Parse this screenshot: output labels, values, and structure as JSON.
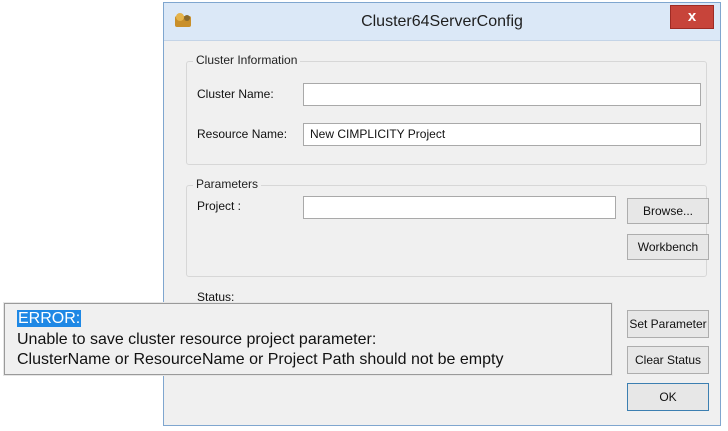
{
  "window": {
    "title": "Cluster64ServerConfig",
    "close_label": "x"
  },
  "cluster_info": {
    "group_label": "Cluster Information",
    "cluster_name_label": "Cluster Name:",
    "cluster_name_value": "",
    "resource_name_label": "Resource Name:",
    "resource_name_value": "New CIMPLICITY Project"
  },
  "parameters": {
    "group_label": "Parameters",
    "project_label": "Project :",
    "project_value": "",
    "browse_label": "Browse...",
    "workbench_label": "Workbench"
  },
  "status": {
    "label": "Status:",
    "set_parameter_label": "Set Parameter",
    "clear_status_label": "Clear Status",
    "ok_label": "OK"
  },
  "error": {
    "heading": "ERROR:",
    "line1": "Unable to save cluster resource project parameter:",
    "line2": "ClusterName or ResourceName or Project Path should not be empty"
  },
  "colors": {
    "highlight": "#1e88e5",
    "close": "#c7443a"
  }
}
